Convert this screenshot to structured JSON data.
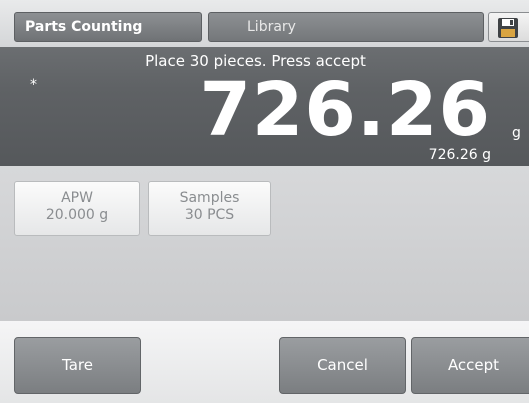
{
  "header": {
    "app_tab": "Parts Counting",
    "library_tab": "Library",
    "save_icon": "floppy-disk-icon"
  },
  "display": {
    "prompt": "Place 30 pieces.  Press accept",
    "stability_indicator": "*",
    "weight": "726.26",
    "unit": "g",
    "sub_weight": "726.26 g"
  },
  "info": {
    "apw_label": "APW",
    "apw_value": "20.000 g",
    "samples_label": "Samples",
    "samples_value": "30 PCS"
  },
  "actions": {
    "tare": "Tare",
    "cancel": "Cancel",
    "accept": "Accept"
  },
  "colors": {
    "display_bg": "#5f6265",
    "button_bg": "#8a8d90",
    "info_text": "#8a8d90"
  }
}
